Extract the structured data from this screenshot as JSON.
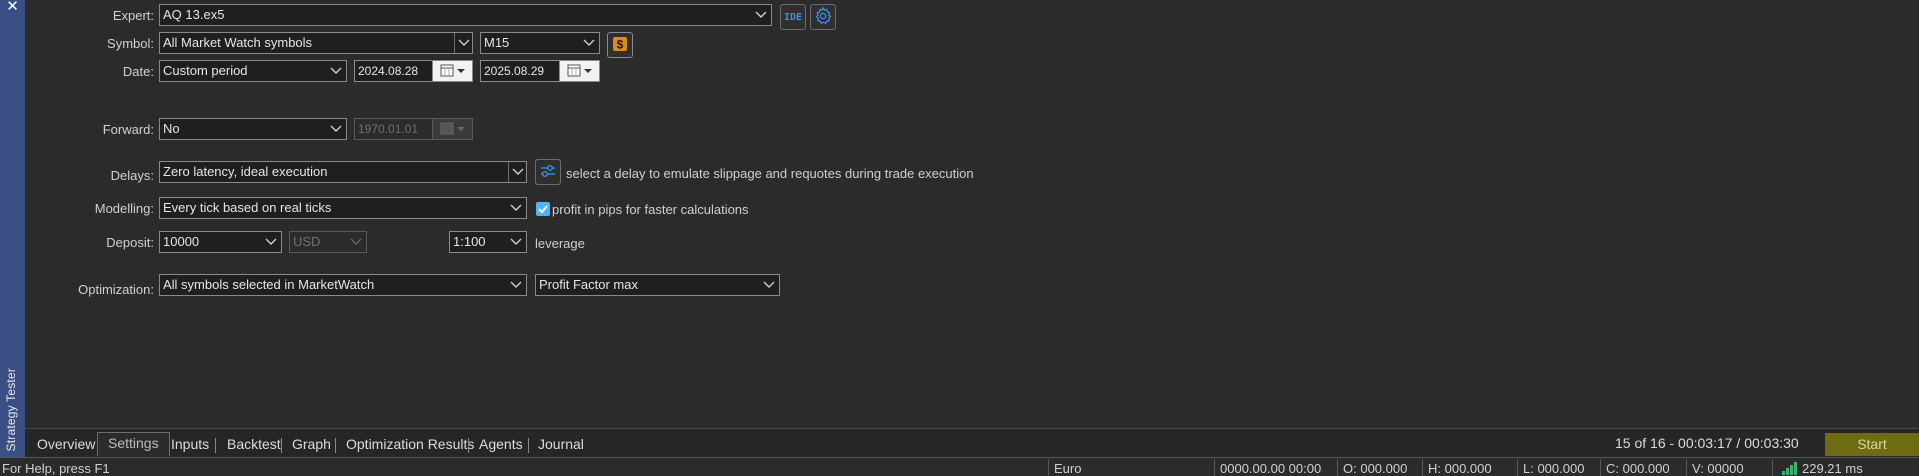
{
  "panel": {
    "side_title": "Strategy Tester",
    "close_glyph": "✕"
  },
  "settings": {
    "expert": {
      "label": "Expert:",
      "value": "AQ 13.ex5",
      "ide_label": "IDE"
    },
    "symbol": {
      "label": "Symbol:",
      "value": "All Market Watch symbols",
      "timeframe": "M15"
    },
    "date": {
      "label": "Date:",
      "value": "Custom period",
      "from": "2024.08.28",
      "to": "2025.08.29"
    },
    "forward": {
      "label": "Forward:",
      "value": "No",
      "date": "1970.01.01"
    },
    "delays": {
      "label": "Delays:",
      "value": "Zero latency, ideal execution",
      "note": "select a delay to emulate slippage and requotes during trade execution"
    },
    "modelling": {
      "label": "Modelling:",
      "value": "Every tick based on real ticks",
      "checkbox_label": "profit in pips for faster calculations",
      "checked": true
    },
    "deposit": {
      "label": "Deposit:",
      "value": "10000",
      "currency": "USD",
      "leverage_value": "1:100",
      "leverage_label": "leverage"
    },
    "optimization": {
      "label": "Optimization:",
      "value": "All symbols selected in MarketWatch",
      "criterion": "Profit Factor max"
    }
  },
  "tabs": [
    {
      "label": "Overview"
    },
    {
      "label": "Settings",
      "selected": true
    },
    {
      "label": "Inputs"
    },
    {
      "label": "Backtest"
    },
    {
      "label": "Graph"
    },
    {
      "label": "Optimization Results"
    },
    {
      "label": "Agents"
    },
    {
      "label": "Journal"
    }
  ],
  "progress_text": "15 of 16  -  00:03:17 / 00:03:30",
  "start_label": "Start",
  "statusbar": {
    "help": "For Help, press F1",
    "symbol": "Euro",
    "datetime": "0000.00.00 00:00",
    "open": "O: 000.000",
    "high": "H: 000.000",
    "low": "L: 000.000",
    "close": "C: 000.000",
    "volume": "V: 00000",
    "ping": "229.21 ms"
  },
  "colors": {
    "accent_blue": "#4db5ff",
    "start_button": "#6e6b10",
    "side_strip": "#3a4f83",
    "money_icon": "#e08a1e"
  }
}
